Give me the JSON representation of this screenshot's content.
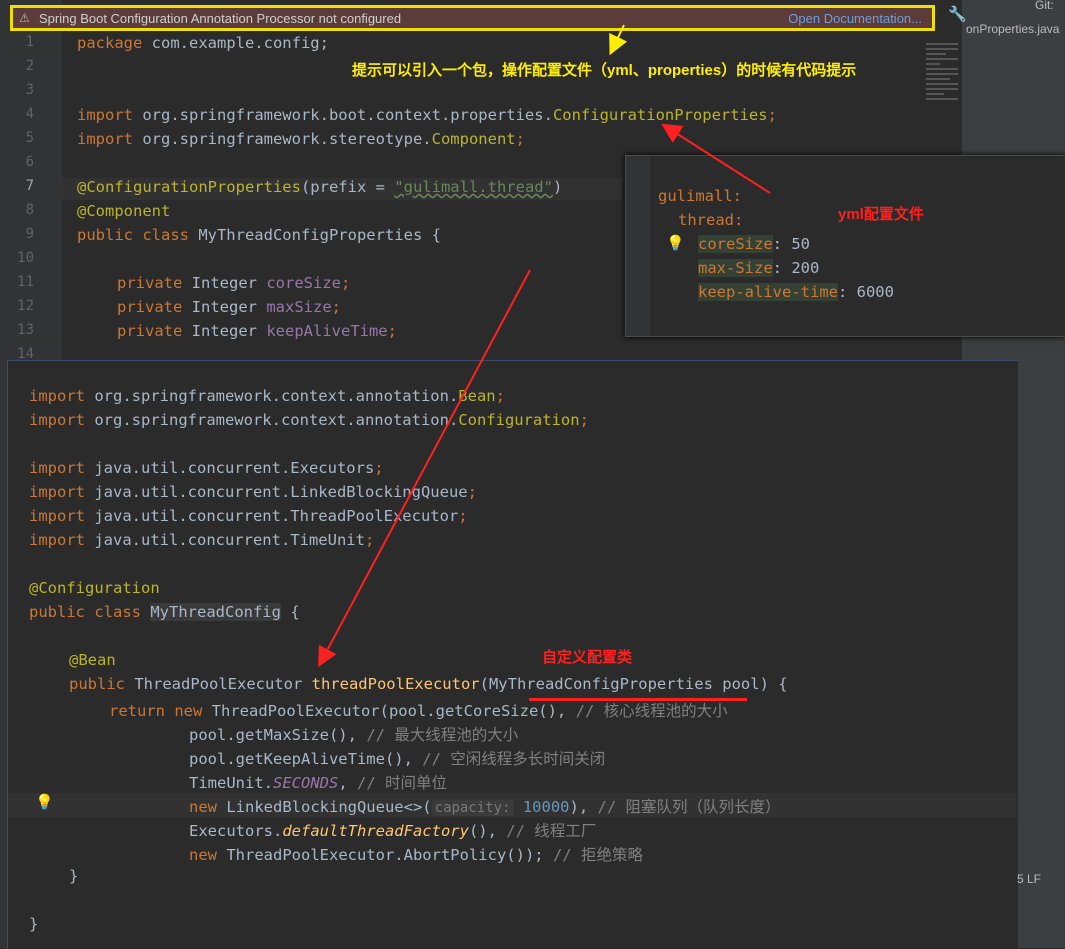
{
  "notification": {
    "text": "Spring Boot Configuration Annotation Processor not configured",
    "link": "Open Documentation..."
  },
  "right_panel": {
    "tab": "onProperties.java",
    "git": "Git:"
  },
  "editor1": {
    "line_numbers": [
      "1",
      "2",
      "3",
      "4",
      "5",
      "6",
      "7",
      "8",
      "9",
      "10",
      "11",
      "12",
      "13",
      "14"
    ],
    "lines": {
      "l1_kw": "package",
      "l1_rest": " com.example.config;",
      "l4_kw": "import",
      "l4_rest": " org.springframework.boot.context.properties.",
      "l4_cls": "ConfigurationProperties",
      "l4_end": ";",
      "l5_kw": "import",
      "l5_rest": " org.springframework.stereotype.",
      "l5_cls": "Component",
      "l5_end": ";",
      "l7_ann": "@ConfigurationProperties",
      "l7_p": "(prefix = ",
      "l7_str": "\"gulimall.thread\"",
      "l7_end": ")",
      "l8_ann": "@Component",
      "l9_kw": "public class",
      "l9_rest": " MyThreadConfigProperties {",
      "l11_kw": "private",
      "l11_type": " Integer ",
      "l11_fld": "coreSize",
      "l11_end": ";",
      "l12_kw": "private",
      "l12_type": " Integer ",
      "l12_fld": "maxSize",
      "l12_end": ";",
      "l13_kw": "private",
      "l13_type": " Integer ",
      "l13_fld": "keepAliveTime",
      "l13_end": ";"
    }
  },
  "annotations": {
    "tip": "提示可以引入一个包，操作配置文件（yml、properties）的时候有代码提示",
    "yml": "yml配置文件",
    "custom": "自定义配置类"
  },
  "yaml": {
    "root": "gulimall:",
    "thread": "thread:",
    "items": [
      {
        "key": "coreSize",
        "value": ": 50"
      },
      {
        "key": "max-Size",
        "value": ": 200"
      },
      {
        "key": "keep-alive-time",
        "value": ": 6000"
      }
    ]
  },
  "editor2": {
    "imports": [
      {
        "kw": "import",
        "pkg": " org.springframework.context.annotation.",
        "cls": "Bean",
        "end": ";"
      },
      {
        "kw": "import",
        "pkg": " org.springframework.context.annotation.",
        "cls": "Configuration",
        "end": ";"
      },
      {
        "kw": "import",
        "pkg": " java.util.concurrent.Executors",
        "cls": "",
        "end": ";"
      },
      {
        "kw": "import",
        "pkg": " java.util.concurrent.LinkedBlockingQueue",
        "cls": "",
        "end": ";"
      },
      {
        "kw": "import",
        "pkg": " java.util.concurrent.ThreadPoolExecutor",
        "cls": "",
        "end": ";"
      },
      {
        "kw": "import",
        "pkg": " java.util.concurrent.TimeUnit",
        "cls": "",
        "end": ";"
      }
    ],
    "config_ann": "@Configuration",
    "class_kw": "public class ",
    "class_name": "MyThreadConfig",
    "class_end": " {",
    "bean_ann": "@Bean",
    "method_kw": "public",
    "method_type": " ThreadPoolExecutor ",
    "method_name": "threadPoolExecutor",
    "method_params": "(MyThreadConfigProperties pool) {",
    "return_kw": "return new",
    "return_rest": " ThreadPoolExecutor(pool.getCoreSize(), ",
    "return_cmt": "// 核心线程池的大小",
    "l2": "pool.getMaxSize(), ",
    "l2_cmt": "// 最大线程池的大小",
    "l3": "pool.getKeepAliveTime(), ",
    "l3_cmt": "// 空闲线程多长时间关闭",
    "l4a": "TimeUnit.",
    "l4b": "SECONDS",
    "l4c": ", ",
    "l4_cmt": "// 时间单位",
    "l5_kw": "new",
    "l5a": " LinkedBlockingQueue<>(",
    "l5_hint": "capacity:",
    "l5_num": " 10000",
    "l5b": "), ",
    "l5_cmt": "// 阻塞队列（队列长度）",
    "l6a": "Executors.",
    "l6b": "defaultThreadFactory",
    "l6c": "(), ",
    "l6_cmt": "// 线程工厂",
    "l7_kw": "new",
    "l7a": " ThreadPoolExecutor.AbortPolicy()); ",
    "l7_cmt": "// 拒绝策略",
    "close_inner": "}",
    "close_outer": "}"
  },
  "status": {
    "text": "5  LF"
  }
}
